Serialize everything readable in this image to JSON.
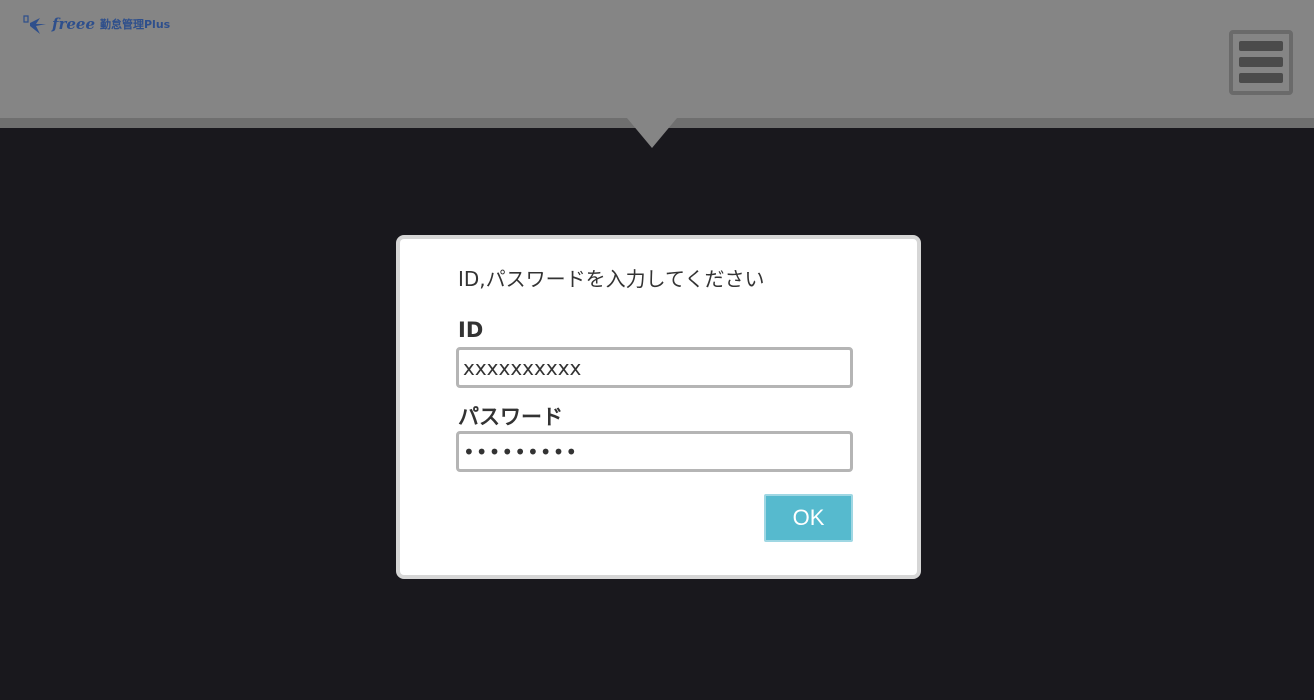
{
  "header": {
    "logo_brand": "freee",
    "logo_text": "勤怠管理Plus",
    "menu_icon": "hamburger-menu-icon"
  },
  "dialog": {
    "message": "ID,パスワードを入力してください",
    "id_label": "ID",
    "id_value": "xxxxxxxxxx",
    "password_label": "パスワード",
    "password_value": "•••••••••",
    "ok_label": "OK"
  },
  "colors": {
    "header_bg": "#858585",
    "page_bg": "#19181d",
    "ok_button": "#56bace",
    "logo": "#2e4f8c"
  }
}
